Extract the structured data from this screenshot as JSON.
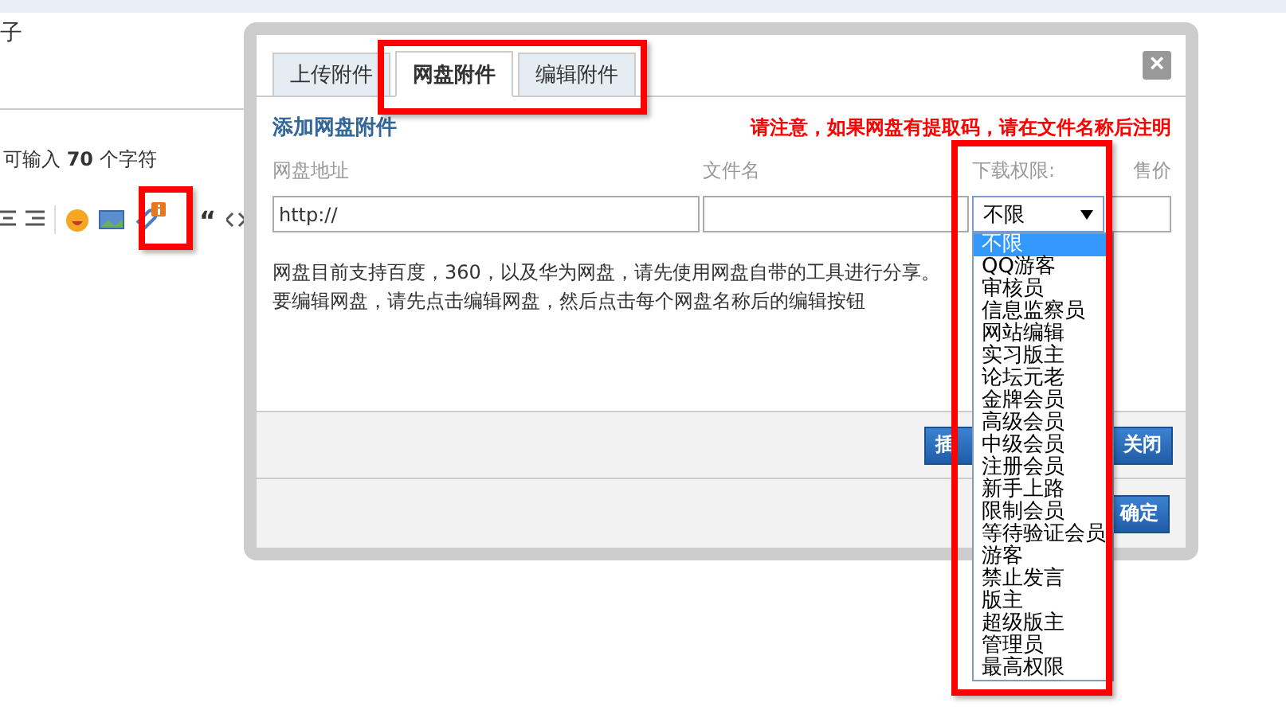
{
  "page": {
    "title_fragment": "子",
    "counter": "可输入 **70** 个字符",
    "toolbar": {
      "quote": "“"
    }
  },
  "dialog": {
    "tabs": [
      {
        "label": "上传附件",
        "selected": false
      },
      {
        "label": "网盘附件",
        "selected": true
      },
      {
        "label": "编辑附件",
        "selected": false
      }
    ],
    "close": "×",
    "heading": "添加网盘附件",
    "notice": "请注意，如果网盘有提取码，请在文件名称后注明",
    "columns": [
      "网盘地址",
      "文件名",
      "下载权限:",
      "售价"
    ],
    "url_value": "http://",
    "select_value": "不限",
    "select_options": [
      {
        "label": "不限",
        "selected": true
      },
      {
        "label": "QQ游客",
        "selected": false
      },
      {
        "label": "审核员",
        "selected": false
      },
      {
        "label": "信息监察员",
        "selected": false
      },
      {
        "label": "网站编辑",
        "selected": false
      },
      {
        "label": "实习版主",
        "selected": false
      },
      {
        "label": "论坛元老",
        "selected": false
      },
      {
        "label": "金牌会员",
        "selected": false
      },
      {
        "label": "高级会员",
        "selected": false
      },
      {
        "label": "中级会员",
        "selected": false
      },
      {
        "label": "注册会员",
        "selected": false
      },
      {
        "label": "新手上路",
        "selected": false
      },
      {
        "label": "限制会员",
        "selected": false
      },
      {
        "label": "等待验证会员",
        "selected": false
      },
      {
        "label": "游客",
        "selected": false
      },
      {
        "label": "禁止发言",
        "selected": false
      },
      {
        "label": "版主",
        "selected": false
      },
      {
        "label": "超级版主",
        "selected": false
      },
      {
        "label": "管理员",
        "selected": false
      },
      {
        "label": "最高权限",
        "selected": false
      }
    ],
    "description": [
      "网盘目前支持百度，360，以及华为网盘，请先使用网盘自带的工具进行分享。",
      "要编辑网盘，请先点击编辑网盘，然后点击每个网盘名称后的编辑按钮"
    ],
    "buttons": [
      "插",
      "关闭"
    ],
    "footer_button": "确定"
  }
}
